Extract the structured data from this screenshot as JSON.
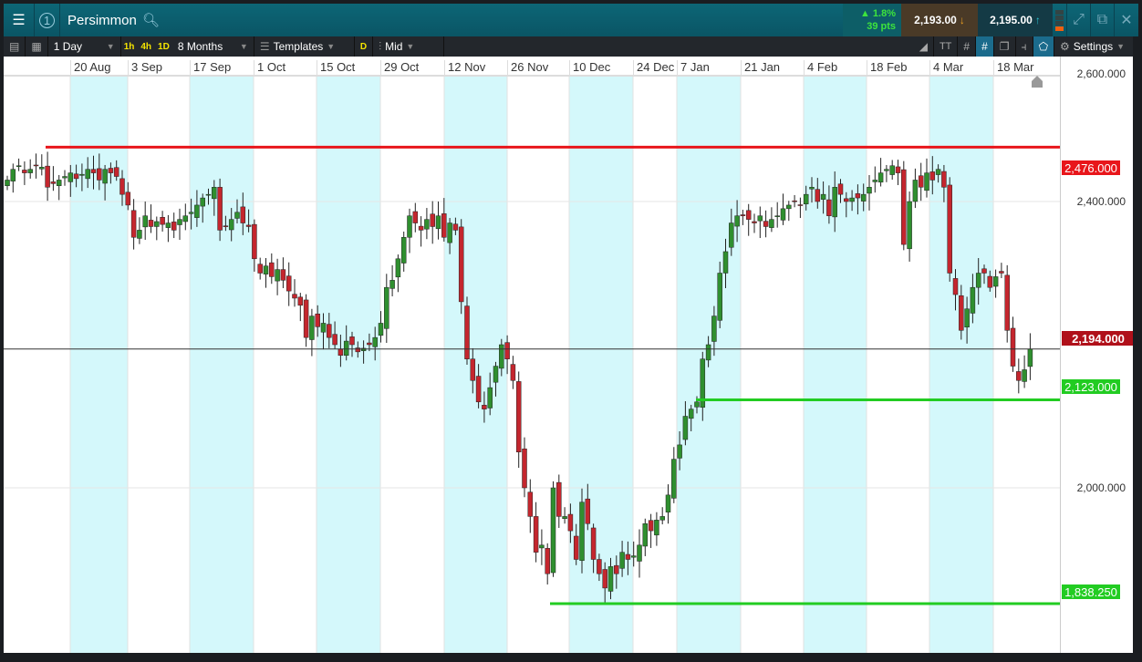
{
  "header": {
    "title": "Persimmon",
    "workspace_number": "1",
    "change_pct": "▲ 1.8%",
    "change_pts": "39 pts",
    "bid": "2,193.00",
    "ask": "2,195.00"
  },
  "toolbar": {
    "interval": "1 Day",
    "quick": [
      "1h",
      "4h",
      "1D"
    ],
    "range": "8 Months",
    "templates": "Templates",
    "d_label": "D",
    "price_type": "Mid",
    "settings": "Settings"
  },
  "colors": {
    "up": "#2f8f2f",
    "down": "#c4262e",
    "band": "#d4f8fb",
    "resistance": "#e8161b",
    "support": "#22cc22"
  },
  "chart_data": {
    "type": "candlestick",
    "title": "Persimmon",
    "x_ticks": [
      "20 Aug",
      "3 Sep",
      "17 Sep",
      "1 Oct",
      "15 Oct",
      "29 Oct",
      "12 Nov",
      "26 Nov",
      "10 Dec",
      "24 Dec",
      "7 Jan",
      "21 Jan",
      "4 Feb",
      "18 Feb",
      "4 Mar",
      "18 Mar"
    ],
    "y_ticks": [
      "2,600.000",
      "2,400.000",
      "2,000.000"
    ],
    "ylim": [
      1750,
      2600
    ],
    "closes": [
      2430,
      2445,
      2450,
      2440,
      2445,
      2450,
      2448,
      2420,
      2425,
      2430,
      2435,
      2440,
      2432,
      2438,
      2445,
      2440,
      2430,
      2445,
      2440,
      2435,
      2410,
      2395,
      2350,
      2360,
      2380,
      2365,
      2372,
      2368,
      2370,
      2360,
      2375,
      2380,
      2385,
      2395,
      2405,
      2410,
      2420,
      2360,
      2365,
      2375,
      2385,
      2370,
      2365,
      2320,
      2300,
      2310,
      2295,
      2305,
      2290,
      2275,
      2265,
      2255,
      2210,
      2240,
      2225,
      2230,
      2210,
      2200,
      2185,
      2205,
      2200,
      2190,
      2195,
      2200,
      2210,
      2230,
      2280,
      2290,
      2320,
      2350,
      2380,
      2370,
      2360,
      2375,
      2365,
      2380,
      2350,
      2370,
      2360,
      2260,
      2180,
      2150,
      2120,
      2110,
      2140,
      2170,
      2200,
      2180,
      2150,
      2050,
      2000,
      1960,
      1910,
      1920,
      1880,
      2000,
      1960,
      1960,
      1940,
      1900,
      1980,
      1950,
      1900,
      1880,
      1860,
      1890,
      1880,
      1910,
      1900,
      1905,
      1920,
      1950,
      1940,
      1955,
      1960,
      1990,
      2040,
      2060,
      2100,
      2110,
      2120,
      2180,
      2200,
      2240,
      2300,
      2330,
      2370,
      2380,
      2380,
      2375,
      2370,
      2380,
      2365,
      2375,
      2380,
      2390,
      2395,
      2400,
      2395,
      2410,
      2420,
      2400,
      2410,
      2380,
      2420,
      2410,
      2400,
      2405,
      2405,
      2410,
      2420,
      2430,
      2440,
      2445,
      2450,
      2440,
      2340,
      2400,
      2430,
      2420,
      2440,
      2430,
      2445,
      2420,
      2300,
      2270,
      2220,
      2250,
      2280,
      2300,
      2300,
      2280,
      2295,
      2300,
      2220,
      2170,
      2150,
      2165,
      2194
    ],
    "lines": [
      {
        "name": "resistance",
        "value": 2476.0,
        "label": "2,476.000"
      },
      {
        "name": "current-price",
        "value": 2194.0,
        "label": "2,194.000"
      },
      {
        "name": "support-1",
        "value": 2123.0,
        "label": "2,123.000"
      },
      {
        "name": "support-2",
        "value": 1838.25,
        "label": "1,838.250"
      }
    ]
  }
}
